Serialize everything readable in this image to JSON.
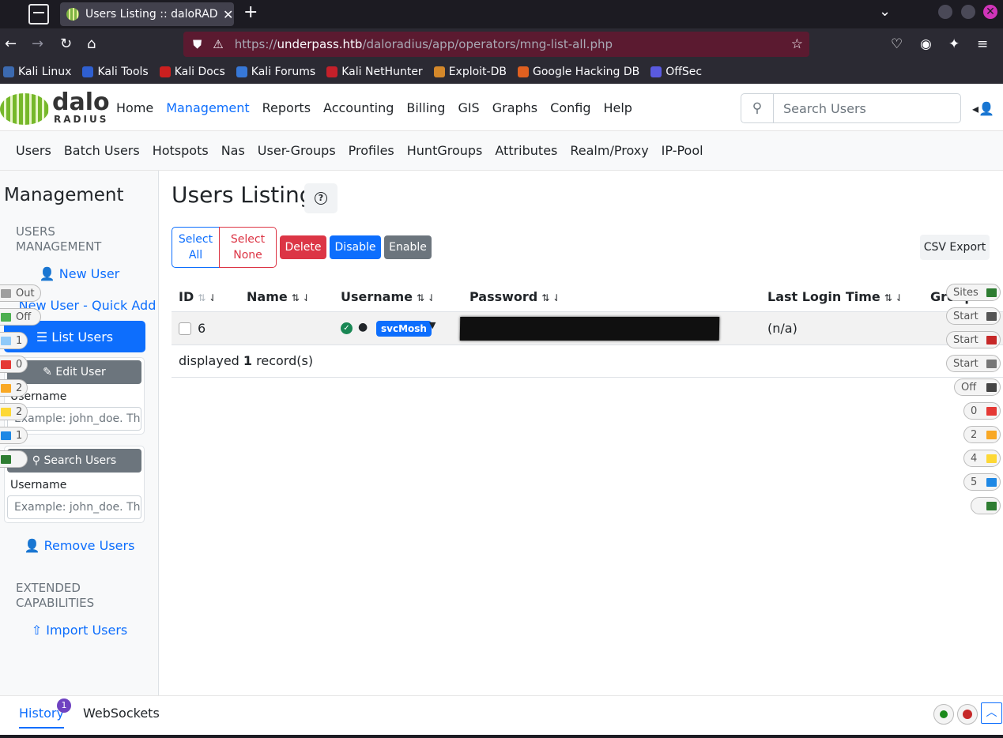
{
  "browser": {
    "tab_title": "Users Listing :: daloRADIUS",
    "url_host": "underpass.htb",
    "url_prefix": "https://",
    "url_path": "/daloradius/app/operators/mng-list-all.php",
    "bookmarks": [
      {
        "label": "Kali Linux",
        "color": "#3c6ab0"
      },
      {
        "label": "Kali Tools",
        "color": "#2f5fd0"
      },
      {
        "label": "Kali Docs",
        "color": "#cc1f1f"
      },
      {
        "label": "Kali Forums",
        "color": "#3778d8"
      },
      {
        "label": "Kali NetHunter",
        "color": "#c4202a"
      },
      {
        "label": "Exploit-DB",
        "color": "#d4882a"
      },
      {
        "label": "Google Hacking DB",
        "color": "#e06020"
      },
      {
        "label": "OffSec",
        "color": "#5a5ae0"
      }
    ]
  },
  "header": {
    "logo_top": "dalo",
    "logo_bottom": "RADIUS",
    "nav": [
      {
        "label": "Home",
        "active": false
      },
      {
        "label": "Management",
        "active": true
      },
      {
        "label": "Reports",
        "active": false
      },
      {
        "label": "Accounting",
        "active": false
      },
      {
        "label": "Billing",
        "active": false
      },
      {
        "label": "GIS",
        "active": false
      },
      {
        "label": "Graphs",
        "active": false
      },
      {
        "label": "Config",
        "active": false
      },
      {
        "label": "Help",
        "active": false
      }
    ],
    "search_placeholder": "Search Users"
  },
  "subnav": [
    "Users",
    "Batch Users",
    "Hotspots",
    "Nas",
    "User-Groups",
    "Profiles",
    "HuntGroups",
    "Attributes",
    "Realm/Proxy",
    "IP-Pool"
  ],
  "sidebar": {
    "title": "Management",
    "section_users": "USERS MANAGEMENT",
    "new_user": "New User",
    "new_user_quick": "New User - Quick Add",
    "list_users": "List Users",
    "edit_user_header": "Edit User",
    "edit_username_label": "Username",
    "edit_username_placeholder": "Example: john_doe. The username",
    "search_users_header": "Search Users",
    "search_username_label": "Username",
    "search_username_placeholder": "Example: john_doe. The username",
    "remove_users": "Remove Users",
    "section_extended": "EXTENDED CAPABILITIES",
    "import_users": "Import Users"
  },
  "main": {
    "title": "Users Listing",
    "buttons": {
      "select_all": "Select All",
      "select_none": "Select None",
      "delete": "Delete",
      "disable": "Disable",
      "enable": "Enable",
      "csv_export": "CSV Export"
    },
    "columns": [
      "ID",
      "Name",
      "Username",
      "Password",
      "Last Login Time",
      "Groups"
    ],
    "rows": [
      {
        "id": "6",
        "name": "",
        "username": "svcMosh",
        "password": "[redacted]",
        "last_login": "(n/a)"
      }
    ],
    "footer_prefix": "displayed",
    "footer_count": "1",
    "footer_suffix": "record(s)"
  },
  "overlay_left": [
    {
      "label": "Out"
    },
    {
      "label": "Off"
    },
    {
      "label": "1"
    },
    {
      "label": "0"
    },
    {
      "label": "2"
    },
    {
      "label": "2"
    },
    {
      "label": "1"
    },
    {
      "label": ""
    }
  ],
  "overlay_right": [
    {
      "label": "Sites"
    },
    {
      "label": "Start"
    },
    {
      "label": "Start"
    },
    {
      "label": "Start"
    },
    {
      "label": "Off"
    },
    {
      "label": "0"
    },
    {
      "label": "2"
    },
    {
      "label": "4"
    },
    {
      "label": "5"
    },
    {
      "label": ""
    }
  ],
  "bottom": {
    "history": "History",
    "history_count": "1",
    "websockets": "WebSockets"
  }
}
